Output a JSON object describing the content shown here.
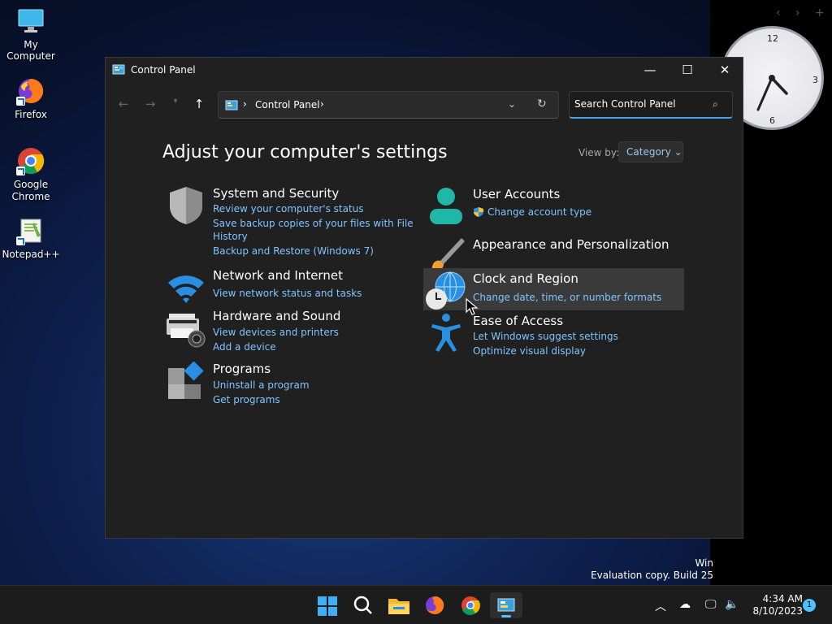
{
  "desktop": {
    "icons": [
      {
        "label": "My Computer"
      },
      {
        "label": "Firefox"
      },
      {
        "label": "Google Chrome"
      },
      {
        "label": "Notepad++"
      }
    ],
    "clock": {
      "num_12": "12",
      "num_3": "3",
      "num_6": "6"
    },
    "watermark": {
      "line1": "Win",
      "line2": "Evaluation copy. Build 25"
    }
  },
  "window": {
    "title": "Control Panel",
    "breadcrumb": "Control Panel",
    "search_placeholder": "Search Control Panel",
    "heading": "Adjust your computer's settings",
    "view_by_label": "View by:",
    "view_by_value": "Category",
    "categories": {
      "system": {
        "title": "System and Security",
        "links": [
          "Review your computer's status",
          "Save backup copies of your files with File",
          "History",
          "Backup and Restore (Windows 7)"
        ]
      },
      "network": {
        "title": "Network and Internet",
        "links": [
          "View network status and tasks"
        ]
      },
      "hardware": {
        "title": "Hardware and Sound",
        "links": [
          "View devices and printers",
          "Add a device"
        ]
      },
      "programs": {
        "title": "Programs",
        "links": [
          "Uninstall a program",
          "Get programs"
        ]
      },
      "users": {
        "title": "User Accounts",
        "links": [
          "Change account type"
        ]
      },
      "appearance": {
        "title": "Appearance and Personalization",
        "links": []
      },
      "clock": {
        "title": "Clock and Region",
        "links": [
          "Change date, time, or number formats"
        ]
      },
      "ease": {
        "title": "Ease of Access",
        "links": [
          "Let Windows suggest settings",
          "Optimize visual display"
        ]
      }
    }
  },
  "taskbar": {
    "time": "4:34 AM",
    "date": "8/10/2023",
    "notification_count": "1"
  },
  "colors": {
    "accent": "#4cc2ff",
    "link": "#80c4ff",
    "window_bg": "#202020"
  }
}
